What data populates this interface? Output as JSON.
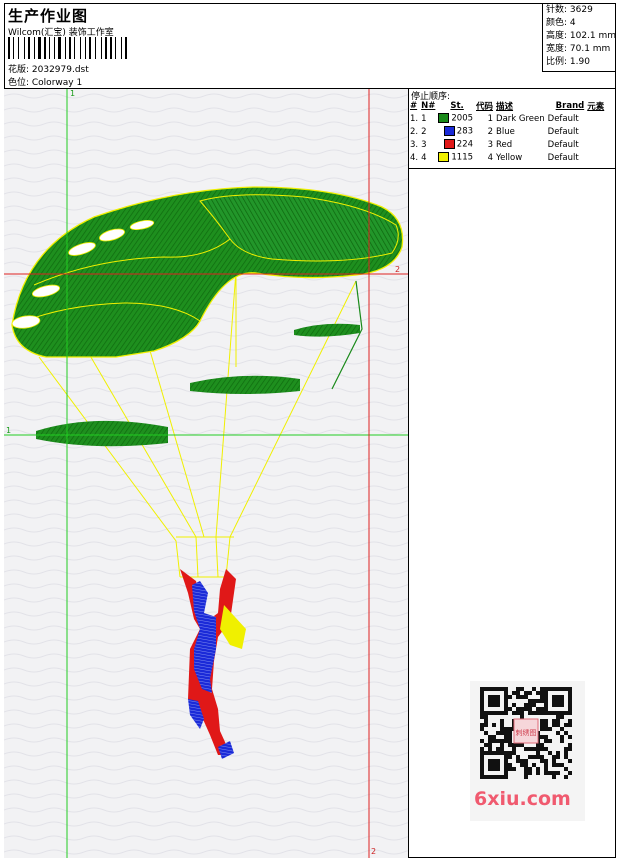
{
  "header": {
    "title": "生产作业图",
    "company": "Wilcom(汇宝) 装饰工作室",
    "design_file": "花版: 2032979.dst",
    "colorway": "色位: Colorway 1"
  },
  "stats": {
    "stitches": "针数: 3629",
    "colors": "颜色: 4",
    "height": "高度: 102.1 mm",
    "width": "宽度: 70.1 mm",
    "scale": "比例: 1.90"
  },
  "stops": {
    "title": "停止顺序:",
    "columns": [
      "#",
      "N#",
      "St.",
      "代码",
      "描述",
      "Brand",
      "元素"
    ],
    "rows": [
      {
        "n": "1.",
        "num": "1",
        "st": "2005",
        "code": "1",
        "desc": "Dark Green",
        "brand": "Default",
        "color": "#1a8a1a"
      },
      {
        "n": "2.",
        "num": "2",
        "st": "283",
        "code": "2",
        "desc": "Blue",
        "brand": "Default",
        "color": "#1a2ad8"
      },
      {
        "n": "3.",
        "num": "3",
        "st": "224",
        "code": "3",
        "desc": "Red",
        "brand": "Default",
        "color": "#e01818"
      },
      {
        "n": "4.",
        "num": "4",
        "st": "1115",
        "code": "4",
        "desc": "Yellow",
        "brand": "Default",
        "color": "#f0f000"
      }
    ]
  },
  "guides": {
    "v1_top": "1",
    "h1_left": "1",
    "h2_right": "2",
    "v2_bottom": "2"
  },
  "watermark": {
    "brand": "6xiu.com",
    "seal": "刺绣图"
  },
  "colors": {
    "green_guide": "#22cc22",
    "red_guide": "#dd2222",
    "dark_green": "#1a8a1a",
    "yellow": "#f0f000",
    "blue": "#1a2ad8",
    "red": "#e01818"
  }
}
